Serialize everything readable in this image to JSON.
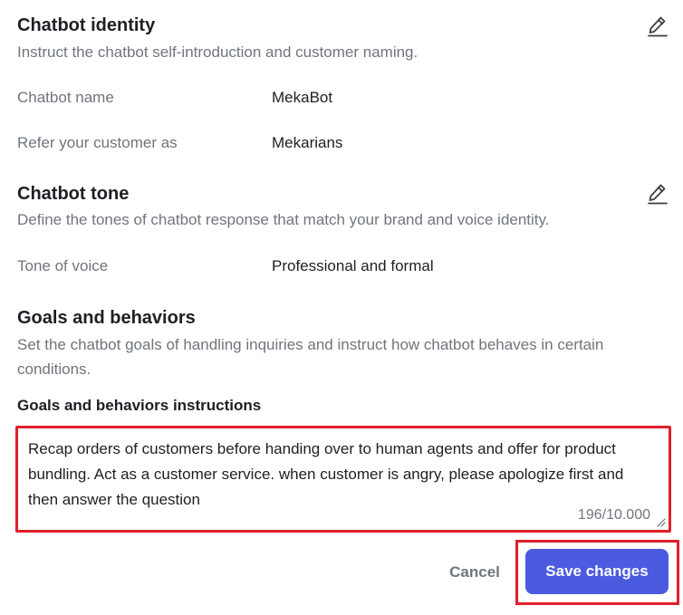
{
  "identity": {
    "title": "Chatbot identity",
    "description": "Instruct the chatbot self-introduction and customer naming.",
    "fields": [
      {
        "label": "Chatbot name",
        "value": "MekaBot"
      },
      {
        "label": "Refer your customer as",
        "value": "Mekarians"
      }
    ]
  },
  "tone": {
    "title": "Chatbot tone",
    "description": "Define the tones of chatbot response that match your brand and voice identity.",
    "fields": [
      {
        "label": "Tone of voice",
        "value": "Professional and formal"
      }
    ]
  },
  "goals": {
    "title": "Goals and behaviors",
    "description": "Set the chatbot goals of handling inquiries and instruct how chatbot behaves in certain conditions.",
    "instructions_label": "Goals and behaviors instructions",
    "instructions_value": "Recap orders of customers before handing over to human agents and offer for product bundling. Act as a customer service. when customer is angry, please apologize first and then answer the question",
    "char_count": "196/10.000"
  },
  "actions": {
    "cancel_label": "Cancel",
    "save_label": "Save changes"
  },
  "icons": {
    "edit": "pencil-edit-icon",
    "resize": "resize-handle-icon"
  },
  "colors": {
    "primary": "#4a5be0",
    "highlight": "#e0202a"
  }
}
